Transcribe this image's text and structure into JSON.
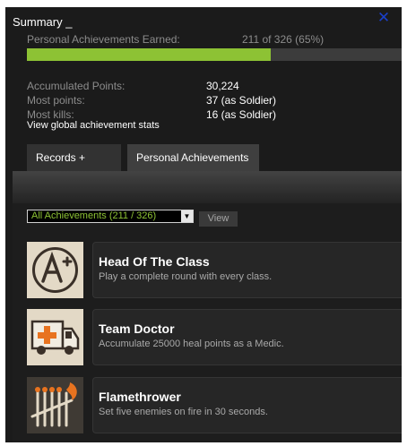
{
  "window": {
    "title": "Summary _",
    "close_icon": "close-icon"
  },
  "summary": {
    "earned_label": "Personal Achievements Earned:",
    "earned_value": "211 of 326 (65%)",
    "earned_fraction": 0.65,
    "stats": [
      {
        "label": "Accumulated Points:",
        "value": "30,224"
      },
      {
        "label": "Most points:",
        "value": "37 (as Soldier)"
      },
      {
        "label": "Most kills:",
        "value": "16 (as Soldier)"
      }
    ],
    "global_link": "View global achievement stats"
  },
  "tabs": [
    {
      "label": "Records + Stats",
      "active": false
    },
    {
      "label": "Personal Achievements",
      "active": true
    }
  ],
  "filter": {
    "selected": "All Achievements (211 / 326)",
    "view_button": "View"
  },
  "achievements": [
    {
      "title": "Head Of The Class",
      "description": "Play a complete round with every class.",
      "icon": "a-plus-grade-icon"
    },
    {
      "title": "Team Doctor",
      "description": "Accumulate 25000 heal points as a Medic.",
      "icon": "ambulance-icon"
    },
    {
      "title": "Flamethrower",
      "description": "Set five enemies on fire in 30 seconds.",
      "icon": "burning-matches-icon"
    }
  ],
  "colors": {
    "accent": "#8dc234",
    "background": "#1b1b1b",
    "close": "#1a3fc9"
  }
}
